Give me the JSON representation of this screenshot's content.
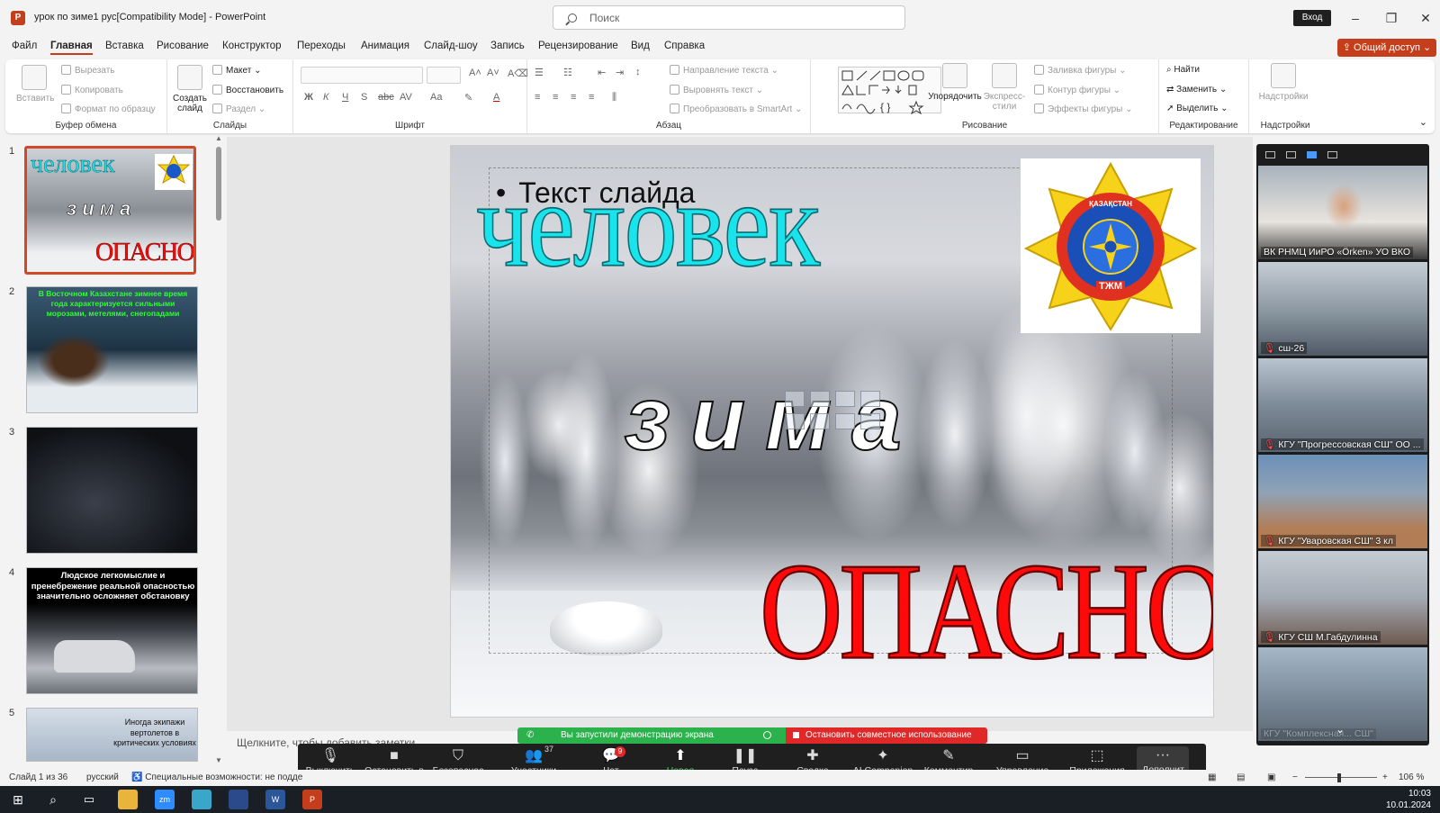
{
  "window": {
    "title": "урок по зиме1 рус[Compatibility Mode]  -  PowerPoint",
    "search_placeholder": "Поиск",
    "login": "Вход",
    "share": "Общий доступ"
  },
  "menu": [
    "Файл",
    "Главная",
    "Вставка",
    "Рисование",
    "Конструктор",
    "Переходы",
    "Анимация",
    "Слайд-шоу",
    "Запись",
    "Рецензирование",
    "Вид",
    "Справка"
  ],
  "ribbon": {
    "clipboard": {
      "label": "Буфер обмена",
      "paste": "Вставить",
      "cut": "Вырезать",
      "copy": "Копировать",
      "format_painter": "Формат по образцу"
    },
    "slides": {
      "label": "Слайды",
      "new_slide": "Создать слайд",
      "layout": "Макет",
      "reset": "Восстановить",
      "section": "Раздел"
    },
    "font": {
      "label": "Шрифт",
      "bold": "Ж",
      "italic": "К",
      "underline": "Ч",
      "shadow": "S",
      "strike": "abc",
      "spacing": "AV",
      "case": "Aa"
    },
    "paragraph": {
      "label": "Абзац",
      "direction": "Направление текста",
      "align": "Выровнять текст",
      "smartart": "Преобразовать в SmartArt"
    },
    "drawing": {
      "label": "Рисование",
      "arrange": "Упорядочить",
      "quick_styles": "Экспресс-стили",
      "fill": "Заливка фигуры",
      "outline": "Контур фигуры",
      "effects": "Эффекты фигуры"
    },
    "editing": {
      "label": "Редактирование",
      "find": "Найти",
      "replace": "Заменить",
      "select": "Выделить"
    },
    "addins": {
      "label": "Надстройки",
      "addins": "Надстройки"
    }
  },
  "thumbnails": [
    {
      "num": "1"
    },
    {
      "num": "2",
      "text": "В Восточном Казахстане зимнее время года характеризуется сильными морозами, метелями, снегопадами"
    },
    {
      "num": "3"
    },
    {
      "num": "4",
      "text": "Людское легкомыслие и пренебрежение реальной опасностью значительно осложняет обстановку"
    },
    {
      "num": "5",
      "text": "Иногда экипажи вертолетов в критических условиях"
    }
  ],
  "slide": {
    "bullet": "Текст слайда",
    "word1": "человек",
    "word2": "зима",
    "word3": "ОПАСНОСТЬ!",
    "emblem_top": "ҚАЗАҚСТАН",
    "emblem_bottom": "ТЖМ"
  },
  "notes_placeholder": "Щелкните, чтобы добавить заметки",
  "video_tiles": [
    {
      "label": "ВК РНМЦ ИиРО «Örken» УО ВКО"
    },
    {
      "label": "сш-26"
    },
    {
      "label": "КГУ \"Прогрессовская СШ\" ОО ..."
    },
    {
      "label": "КГУ \"Уваровская СШ\" 3 кл"
    },
    {
      "label": "КГУ СШ М.Габдулинна"
    },
    {
      "label": "КГУ \"Комплексная... СШ\""
    }
  ],
  "zoom": {
    "banner": "Вы запустили демонстрацию экрана",
    "stop": "Остановить совместное использование",
    "buttons": [
      "Выключить",
      "Остановить в",
      "Безопаснос",
      "Участники",
      "Чат",
      "Новая демон",
      "Пауза демон",
      "Сводка",
      "AI Companion",
      "Комментир",
      "Управление слайд",
      "Приложения",
      "Дополнит"
    ],
    "participants": "37",
    "chat_badge": "9"
  },
  "status": {
    "slide": "Слайд 1 из 36",
    "language": "русский",
    "accessibility": "Специальные возможности: не подде",
    "zoom": "106 %"
  },
  "taskbar": {
    "time": "10:03",
    "date": "10.01.2024"
  },
  "colors": {
    "accent": "#c43e1c",
    "zoom_green": "#2bb24c",
    "zoom_red": "#e02828",
    "title_cyan": "#19e4ec",
    "danger_red": "#ff0a0a"
  }
}
